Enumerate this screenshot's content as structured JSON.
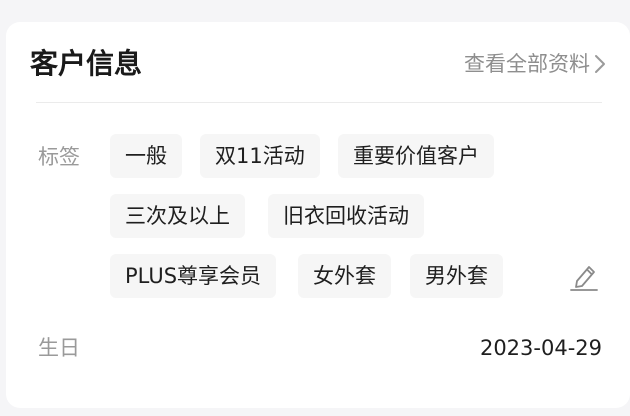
{
  "card": {
    "title": "客户信息",
    "view_all_label": "查看全部资料",
    "view_all_icon": "chevron-right-icon"
  },
  "tags": {
    "label": "标签",
    "items": [
      "一般",
      "双11活动",
      "重要价值客户",
      "三次及以上",
      "旧衣回收活动",
      "PLUS尊享会员",
      "女外套",
      "男外套"
    ],
    "edit_icon": "pencil-edit-icon"
  },
  "birthday": {
    "label": "生日",
    "value": "2023-04-29"
  },
  "colors": {
    "tag_background": "#f6f6f6",
    "label_gray": "#9a9a9a",
    "text_dark": "#1f1f1f"
  }
}
